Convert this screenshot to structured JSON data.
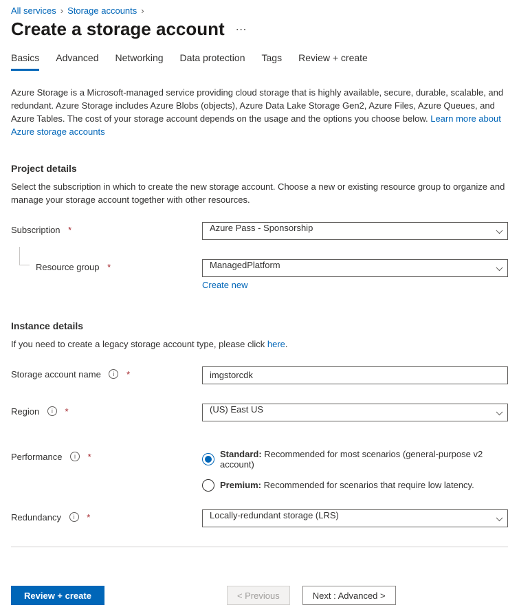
{
  "breadcrumb": {
    "item1": "All services",
    "item2": "Storage accounts"
  },
  "title": "Create a storage account",
  "tabs": [
    "Basics",
    "Advanced",
    "Networking",
    "Data protection",
    "Tags",
    "Review + create"
  ],
  "intro": {
    "text": "Azure Storage is a Microsoft-managed service providing cloud storage that is highly available, secure, durable, scalable, and redundant. Azure Storage includes Azure Blobs (objects), Azure Data Lake Storage Gen2, Azure Files, Azure Queues, and Azure Tables. The cost of your storage account depends on the usage and the options you choose below. ",
    "link": "Learn more about Azure storage accounts"
  },
  "project": {
    "heading": "Project details",
    "desc": "Select the subscription in which to create the new storage account. Choose a new or existing resource group to organize and manage your storage account together with other resources.",
    "subscription_label": "Subscription",
    "subscription_value": "Azure Pass - Sponsorship",
    "rg_label": "Resource group",
    "rg_value": "ManagedPlatform",
    "rg_create": "Create new"
  },
  "instance": {
    "heading": "Instance details",
    "desc_prefix": "If you need to create a legacy storage account type, please click ",
    "desc_link": "here",
    "name_label": "Storage account name",
    "name_value": "imgstorcdk",
    "region_label": "Region",
    "region_value": "(US) East US",
    "perf_label": "Performance",
    "perf_standard_bold": "Standard:",
    "perf_standard_desc": " Recommended for most scenarios (general-purpose v2 account)",
    "perf_premium_bold": "Premium:",
    "perf_premium_desc": " Recommended for scenarios that require low latency.",
    "redundancy_label": "Redundancy",
    "redundancy_value": "Locally-redundant storage (LRS)"
  },
  "footer": {
    "review": "Review + create",
    "previous": "< Previous",
    "next": "Next : Advanced >"
  }
}
